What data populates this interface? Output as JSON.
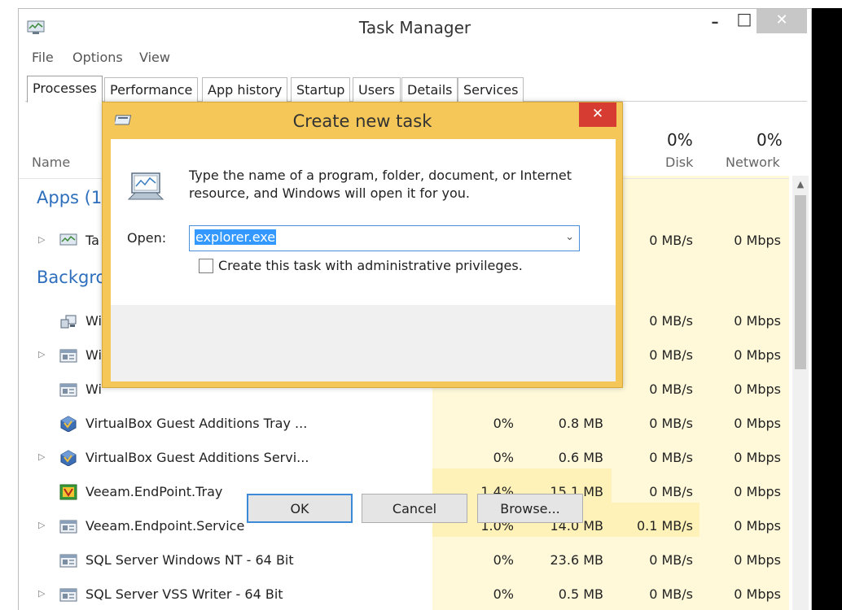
{
  "window": {
    "title": "Task Manager",
    "minimize_glyph": "–",
    "maximize_glyph": "□",
    "close_glyph": "✕"
  },
  "menu": [
    "File",
    "Options",
    "View"
  ],
  "tabs": [
    "Processes",
    "Performance",
    "App history",
    "Startup",
    "Users",
    "Details",
    "Services"
  ],
  "columns": {
    "name": "Name",
    "disk": {
      "pct": "0%",
      "label": "Disk"
    },
    "network": {
      "pct": "0%",
      "label": "Network"
    }
  },
  "sections": {
    "apps": "Apps (1",
    "background": "Backgro"
  },
  "rows": [
    {
      "name": "Ta",
      "cpu": "",
      "mem": "",
      "disk": "0 MB/s",
      "net": "0 Mbps",
      "expand": true,
      "icon": "task-manager-icon"
    },
    {
      "name": "Wi",
      "cpu": "",
      "mem": "",
      "disk": "0 MB/s",
      "net": "0 Mbps",
      "expand": false,
      "icon": "network-computer-icon"
    },
    {
      "name": "Wi",
      "cpu": "",
      "mem": "",
      "disk": "0 MB/s",
      "net": "0 Mbps",
      "expand": true,
      "icon": "service-window-icon"
    },
    {
      "name": "Wi",
      "cpu": "",
      "mem": "",
      "disk": "0 MB/s",
      "net": "0 Mbps",
      "expand": false,
      "icon": "service-window-icon"
    },
    {
      "name": "VirtualBox Guest Additions Tray ...",
      "cpu": "0%",
      "mem": "0.8 MB",
      "disk": "0 MB/s",
      "net": "0 Mbps",
      "expand": false,
      "icon": "virtualbox-icon"
    },
    {
      "name": "VirtualBox Guest Additions Servi...",
      "cpu": "0%",
      "mem": "0.6 MB",
      "disk": "0 MB/s",
      "net": "0 Mbps",
      "expand": true,
      "icon": "virtualbox-icon"
    },
    {
      "name": "Veeam.EndPoint.Tray",
      "cpu": "1.4%",
      "mem": "15.1 MB",
      "disk": "0 MB/s",
      "net": "0 Mbps",
      "expand": false,
      "icon": "veeam-icon"
    },
    {
      "name": "Veeam.Endpoint.Service",
      "cpu": "1.0%",
      "mem": "14.0 MB",
      "disk": "0.1 MB/s",
      "net": "0 Mbps",
      "expand": true,
      "icon": "service-window-icon"
    },
    {
      "name": "SQL Server Windows NT - 64 Bit",
      "cpu": "0%",
      "mem": "23.6 MB",
      "disk": "0 MB/s",
      "net": "0 Mbps",
      "expand": false,
      "icon": "service-window-icon"
    },
    {
      "name": "SQL Server VSS Writer - 64 Bit",
      "cpu": "0%",
      "mem": "0.5 MB",
      "disk": "0 MB/s",
      "net": "0 Mbps",
      "expand": true,
      "icon": "service-window-icon"
    }
  ],
  "dialog": {
    "title": "Create new task",
    "close_glyph": "✕",
    "description_line1": "Type the name of a program, folder, document, or Internet",
    "description_line2": "resource, and Windows will open it for you.",
    "open_label": "Open:",
    "open_value": "explorer.exe",
    "admin_checkbox_label": "Create this task with administrative privileges.",
    "admin_checked": false,
    "ok_label": "OK",
    "cancel_label": "Cancel",
    "browse_label": "Browse..."
  },
  "colors": {
    "section_blue": "#2e6fbd",
    "heat_light": "#fff9da",
    "heat_mid": "#fff2b8",
    "dialog_frame": "#f4c758",
    "dialog_close": "#d63c32"
  }
}
